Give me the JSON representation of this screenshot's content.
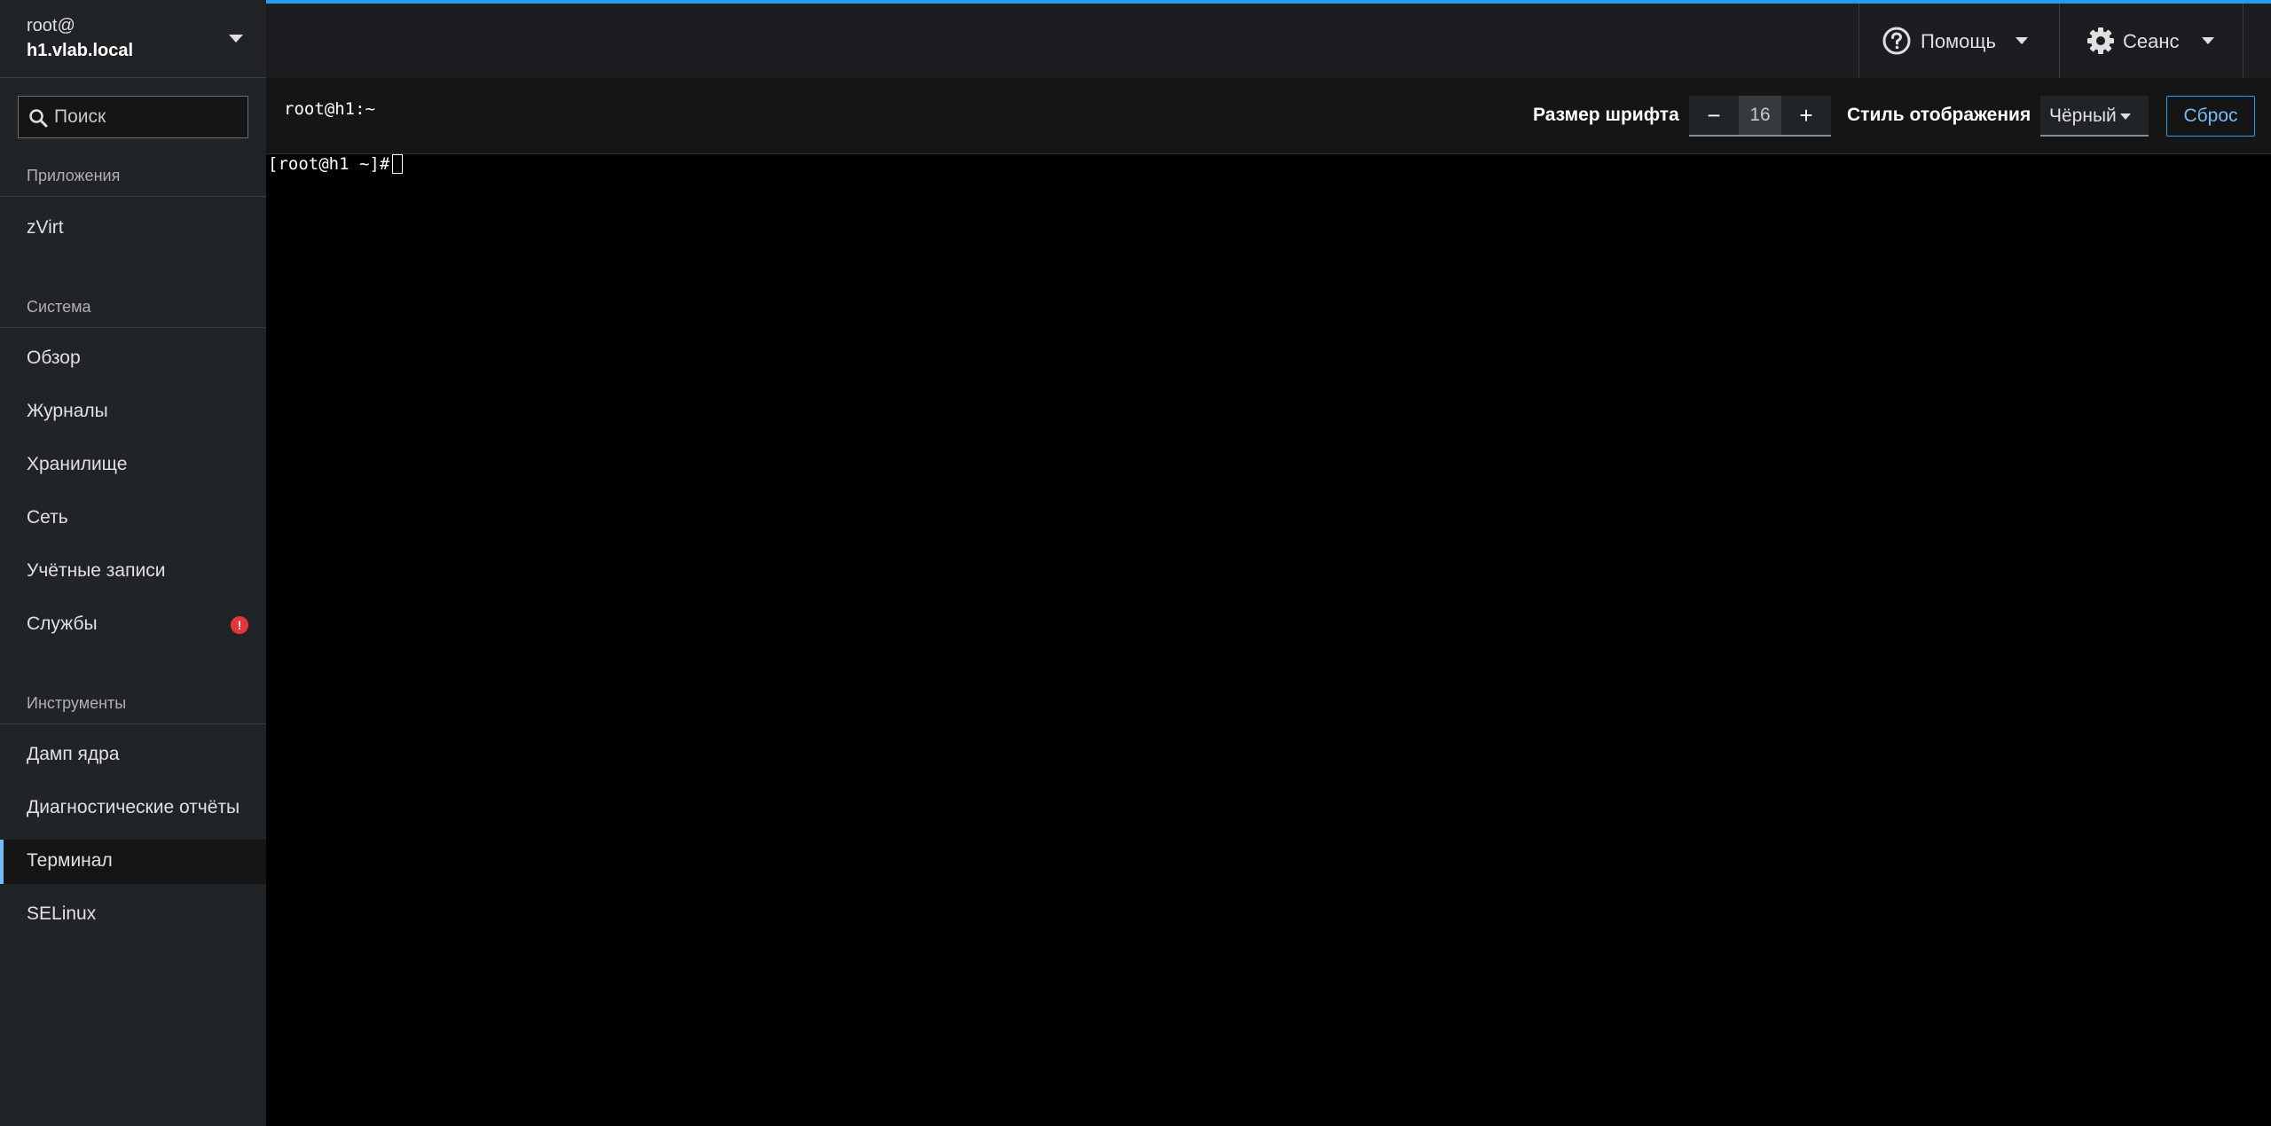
{
  "host": {
    "user": "root@",
    "name": "h1.vlab.local"
  },
  "search": {
    "placeholder": "Поиск"
  },
  "sidebar": {
    "sections": [
      {
        "title": "Приложения",
        "items": [
          {
            "label": "zVirt"
          }
        ]
      },
      {
        "title": "Система",
        "items": [
          {
            "label": "Обзор"
          },
          {
            "label": "Журналы"
          },
          {
            "label": "Хранилище"
          },
          {
            "label": "Сеть"
          },
          {
            "label": "Учётные записи"
          },
          {
            "label": "Службы",
            "alert": "!"
          }
        ]
      },
      {
        "title": "Инструменты",
        "items": [
          {
            "label": "Дамп ядра"
          },
          {
            "label": "Диагностические отчёты"
          },
          {
            "label": "Терминал",
            "active": true
          },
          {
            "label": "SELinux"
          }
        ]
      }
    ]
  },
  "masthead": {
    "help_label": "Помощь",
    "session_label": "Сеанс",
    "accent_color": "#2b9af3"
  },
  "terminal_toolbar": {
    "title": "root@h1:~",
    "font_size_label": "Размер шрифта",
    "font_minus": "−",
    "font_size_value": "16",
    "font_plus": "+",
    "style_label": "Стиль отображения",
    "style_value": "Чёрный",
    "reset_label": "Сброс"
  },
  "terminal": {
    "prompt": "[root@h1 ~]# "
  },
  "icons": {
    "search": "search-icon",
    "help": "question-circle-icon",
    "session": "gear-icon"
  }
}
